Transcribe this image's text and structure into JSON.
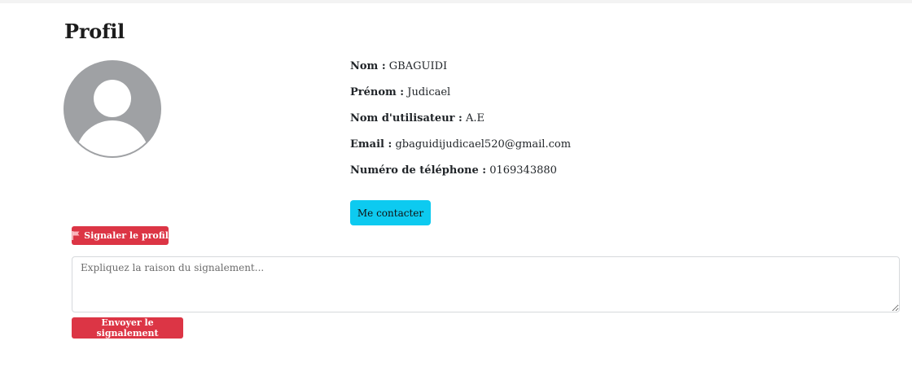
{
  "page": {
    "title": "Profil"
  },
  "avatar": {
    "icon": "user-placeholder-icon",
    "bg_color": "#9fa1a4",
    "fg_color": "#ffffff"
  },
  "profile": {
    "fields": [
      {
        "label": "Nom :",
        "value": "GBAGUIDI"
      },
      {
        "label": "Prénom :",
        "value": "Judicael"
      },
      {
        "label": "Nom d'utilisateur :",
        "value": "A.E"
      },
      {
        "label": "Email :",
        "value": "gbaguidijudicael520@gmail.com"
      },
      {
        "label": "Numéro de téléphone :",
        "value": "0169343880"
      }
    ]
  },
  "contact": {
    "label": "Me contacter",
    "color": "#0dcaf0"
  },
  "report": {
    "button_label": "Signaler le profil",
    "icon": "flag-icon",
    "reason_placeholder": "Expliquez la raison du signalement...",
    "reason_value": "",
    "send_label": "Envoyer le signalement",
    "color": "#dc3545"
  }
}
